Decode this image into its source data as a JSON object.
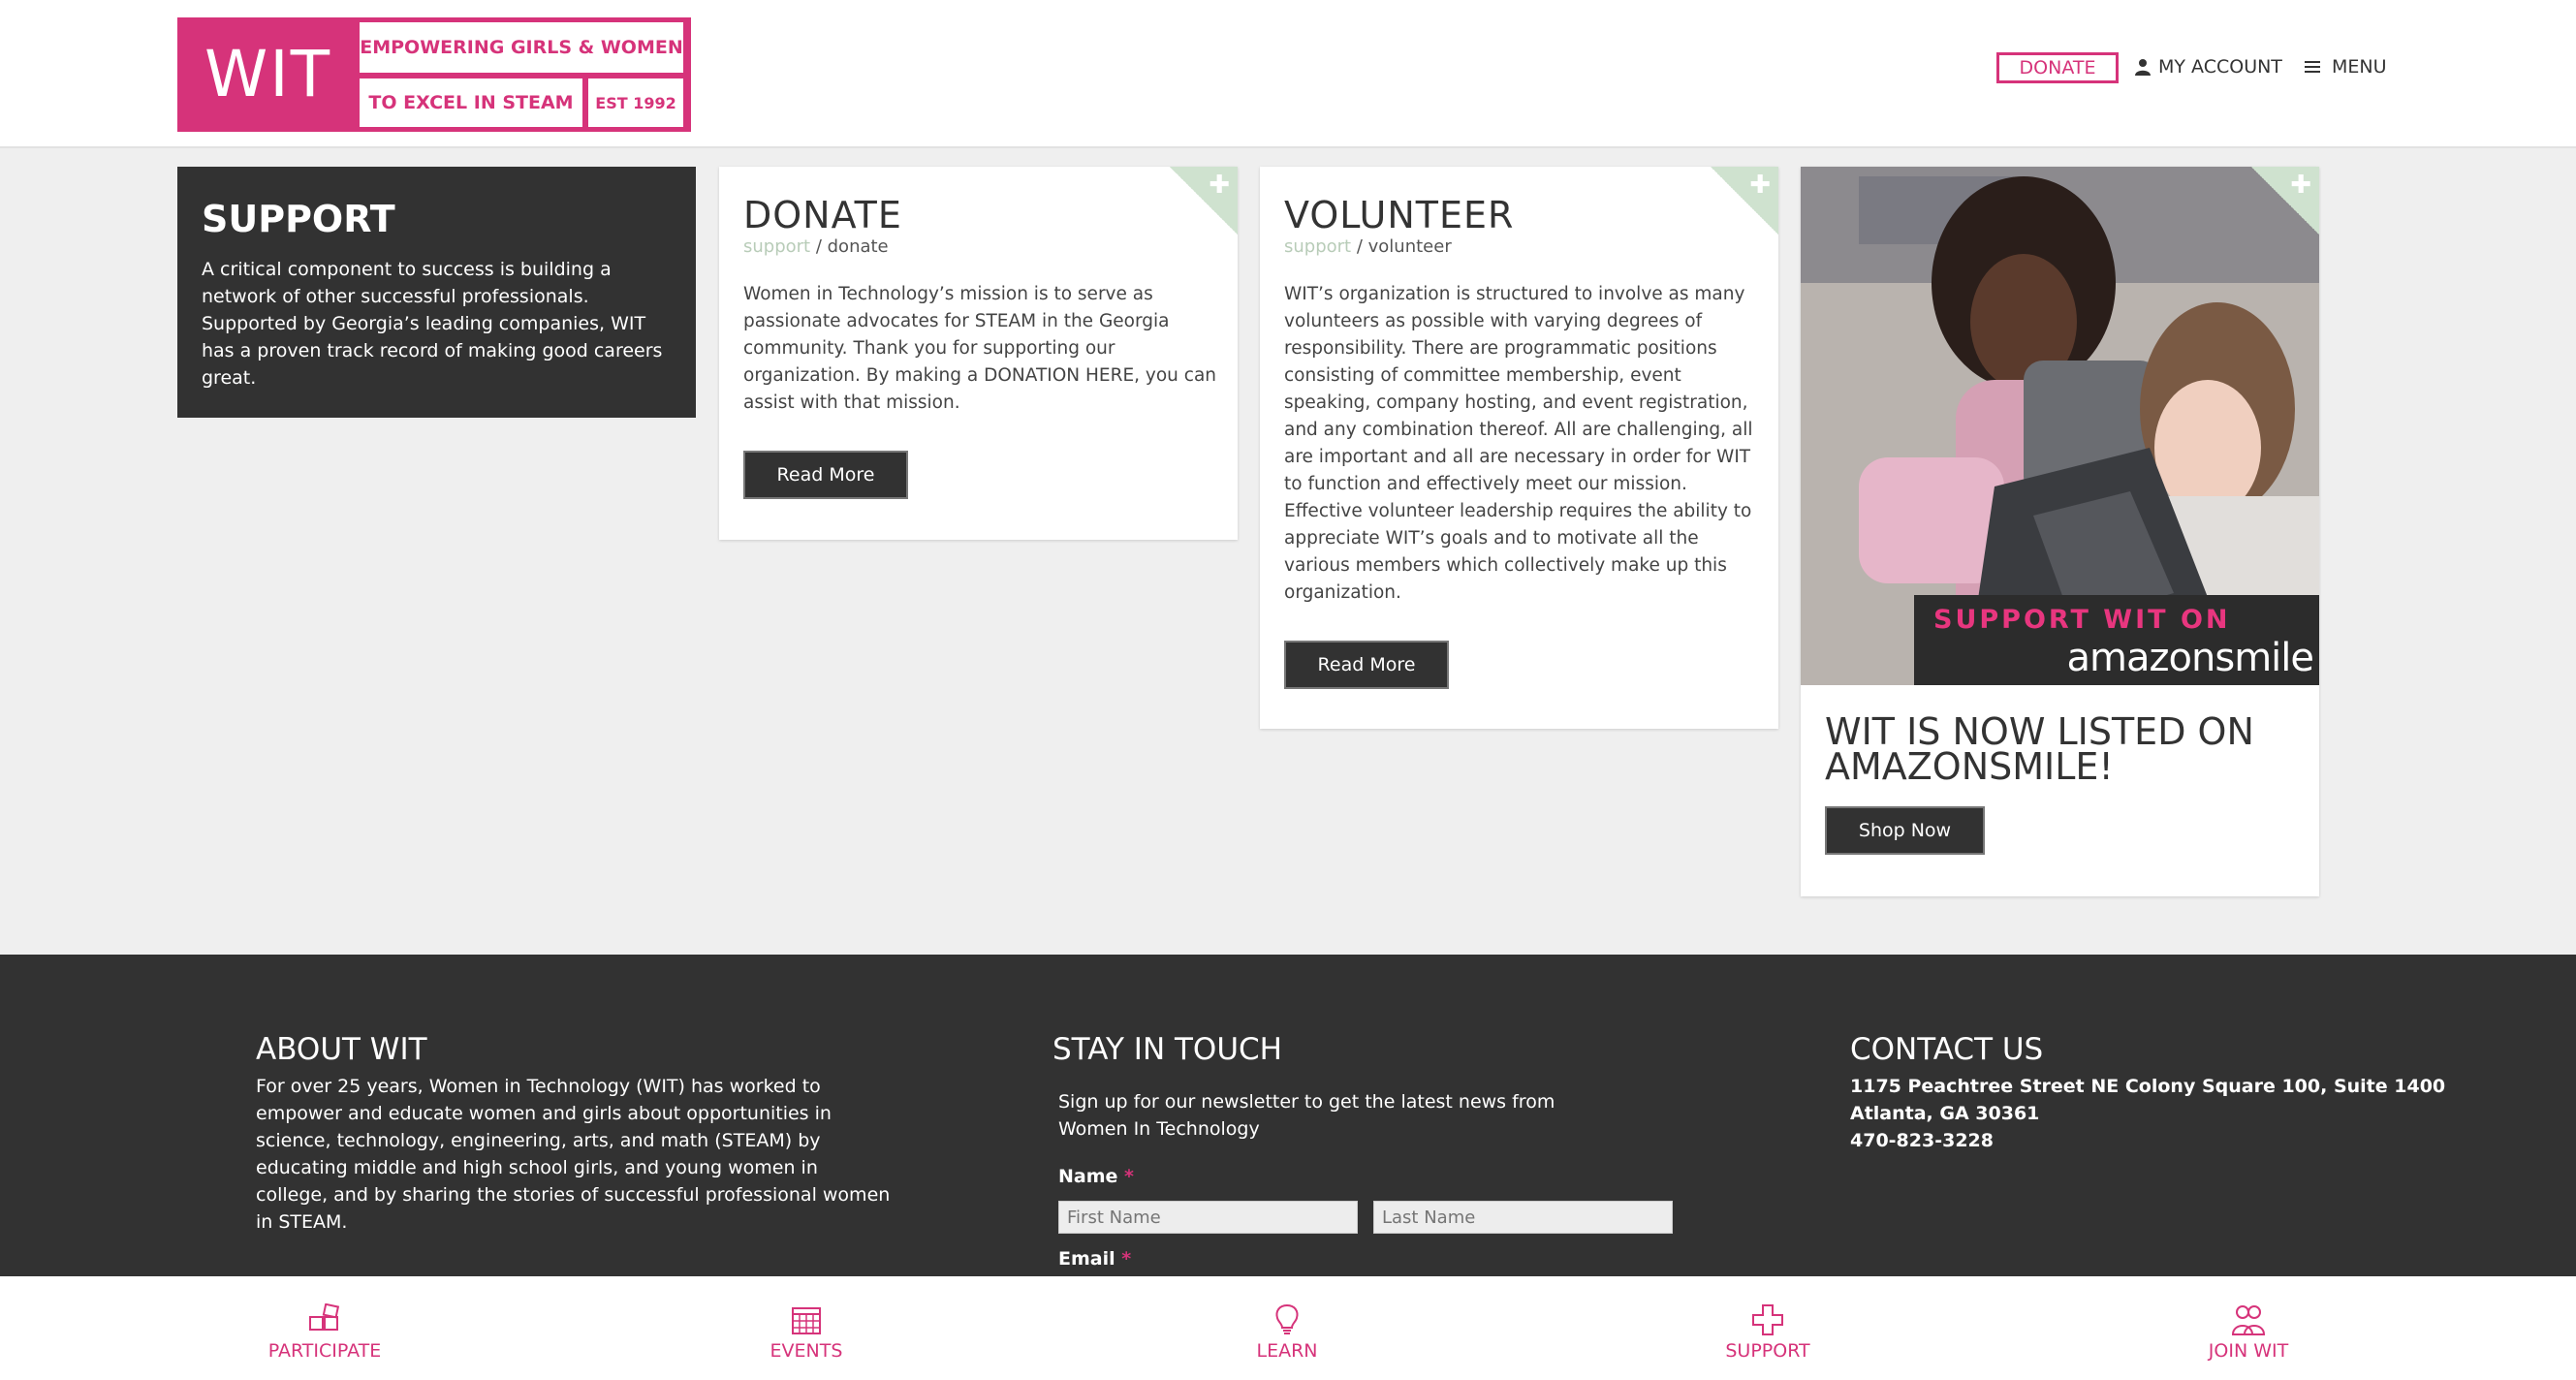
{
  "brand": {
    "logo_text": "WIT",
    "tagline_1": "EMPOWERING GIRLS & WOMEN",
    "tagline_2": "TO EXCEL IN STEAM",
    "established": "EST 1992",
    "accent_color": "#d6337a"
  },
  "nav": {
    "donate_label": "DONATE",
    "account_label": "MY ACCOUNT",
    "menu_label": "MENU",
    "account_icon": "user-icon",
    "menu_icon": "hamburger-icon"
  },
  "support": {
    "title": "SUPPORT",
    "text": "A critical component to success is building a network of other successful professionals. Supported by Georgia’s leading companies, WIT has a proven track record of making good careers great."
  },
  "donate": {
    "title": "DONATE",
    "crumb_parent": "support",
    "crumb_sep": " / ",
    "crumb_current": "donate",
    "text": "Women in Technology’s mission is to serve as passionate advocates for STEAM in the Georgia community. Thank you for supporting our organization. By making a DONATION HERE, you can assist with that mission.",
    "button": "Read More"
  },
  "volunteer": {
    "title": "VOLUNTEER",
    "crumb_parent": "support",
    "crumb_sep": " / ",
    "crumb_current": "volunteer",
    "text": "WIT’s organization is structured to involve as many volunteers as possible with varying degrees of responsibility. There are programmatic positions consisting of committee membership, event speaking, company hosting, and event registration, and any combination thereof. All are challenging, all are important and all are necessary in order for WIT to function and effectively meet our mission. Effective volunteer leadership requires the ability to appreciate WIT’s goals and to motivate all the various members which collectively make up this organization.",
    "button": "Read More"
  },
  "amazon": {
    "banner_line1": "SUPPORT WIT ON",
    "banner_line2": "amazonsmile",
    "title": "WIT IS NOW LISTED ON AMAZONSMILE!",
    "button": "Shop Now"
  },
  "footer": {
    "about_title": "ABOUT WIT",
    "about_text": "For over 25 years, Women in Technology (WIT) has worked to empower and educate women and girls about opportunities in science, technology, engineering, arts, and math (STEAM) by educating middle and high school girls, and young women in college, and by sharing the stories of successful professional women in STEAM.",
    "stay_title": "STAY IN TOUCH",
    "stay_text": "Sign up for our newsletter to get the latest news from Women In Technology",
    "name_label": "Name",
    "required_mark": "*",
    "first_name_placeholder": "First Name",
    "last_name_placeholder": "Last Name",
    "email_label": "Email",
    "contact_title": "CONTACT US",
    "address_1": "1175 Peachtree Street NE Colony Square 100, Suite 1400",
    "address_2": "Atlanta, GA 30361",
    "phone": "470-823-3228"
  },
  "bottom_nav": [
    {
      "label": "PARTICIPATE",
      "icon": "squares-icon"
    },
    {
      "label": "EVENTS",
      "icon": "calendar-icon"
    },
    {
      "label": "LEARN",
      "icon": "lightbulb-icon"
    },
    {
      "label": "SUPPORT",
      "icon": "plus-icon"
    },
    {
      "label": "JOIN WIT",
      "icon": "people-icon"
    }
  ]
}
